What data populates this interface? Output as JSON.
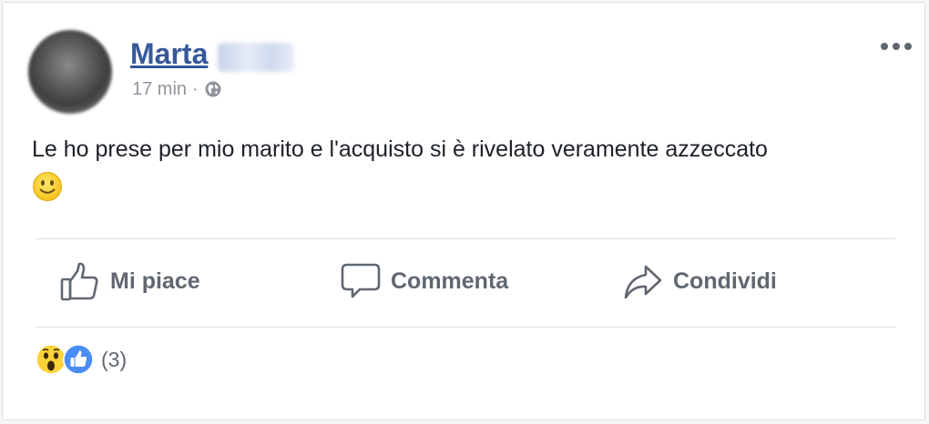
{
  "post": {
    "author_first_name": "Marta",
    "timestamp": "17 min",
    "separator": "·",
    "privacy_icon": "globe-icon",
    "text": "Le ho prese per mio marito e l'acquisto si è rivelato veramente azzeccato",
    "emoji": "slightly-smiling-face-icon"
  },
  "actions": {
    "like_label": "Mi piace",
    "comment_label": "Commenta",
    "share_label": "Condividi"
  },
  "reactions": {
    "icons": [
      "wow-reaction-icon",
      "like-reaction-icon"
    ],
    "count": "(3)"
  },
  "colors": {
    "link_blue": "#365899",
    "action_gray": "#606770",
    "meta_gray": "#90949c",
    "like_blue": "#4a8ef5",
    "emoji_yellow": "#ffd23a"
  }
}
